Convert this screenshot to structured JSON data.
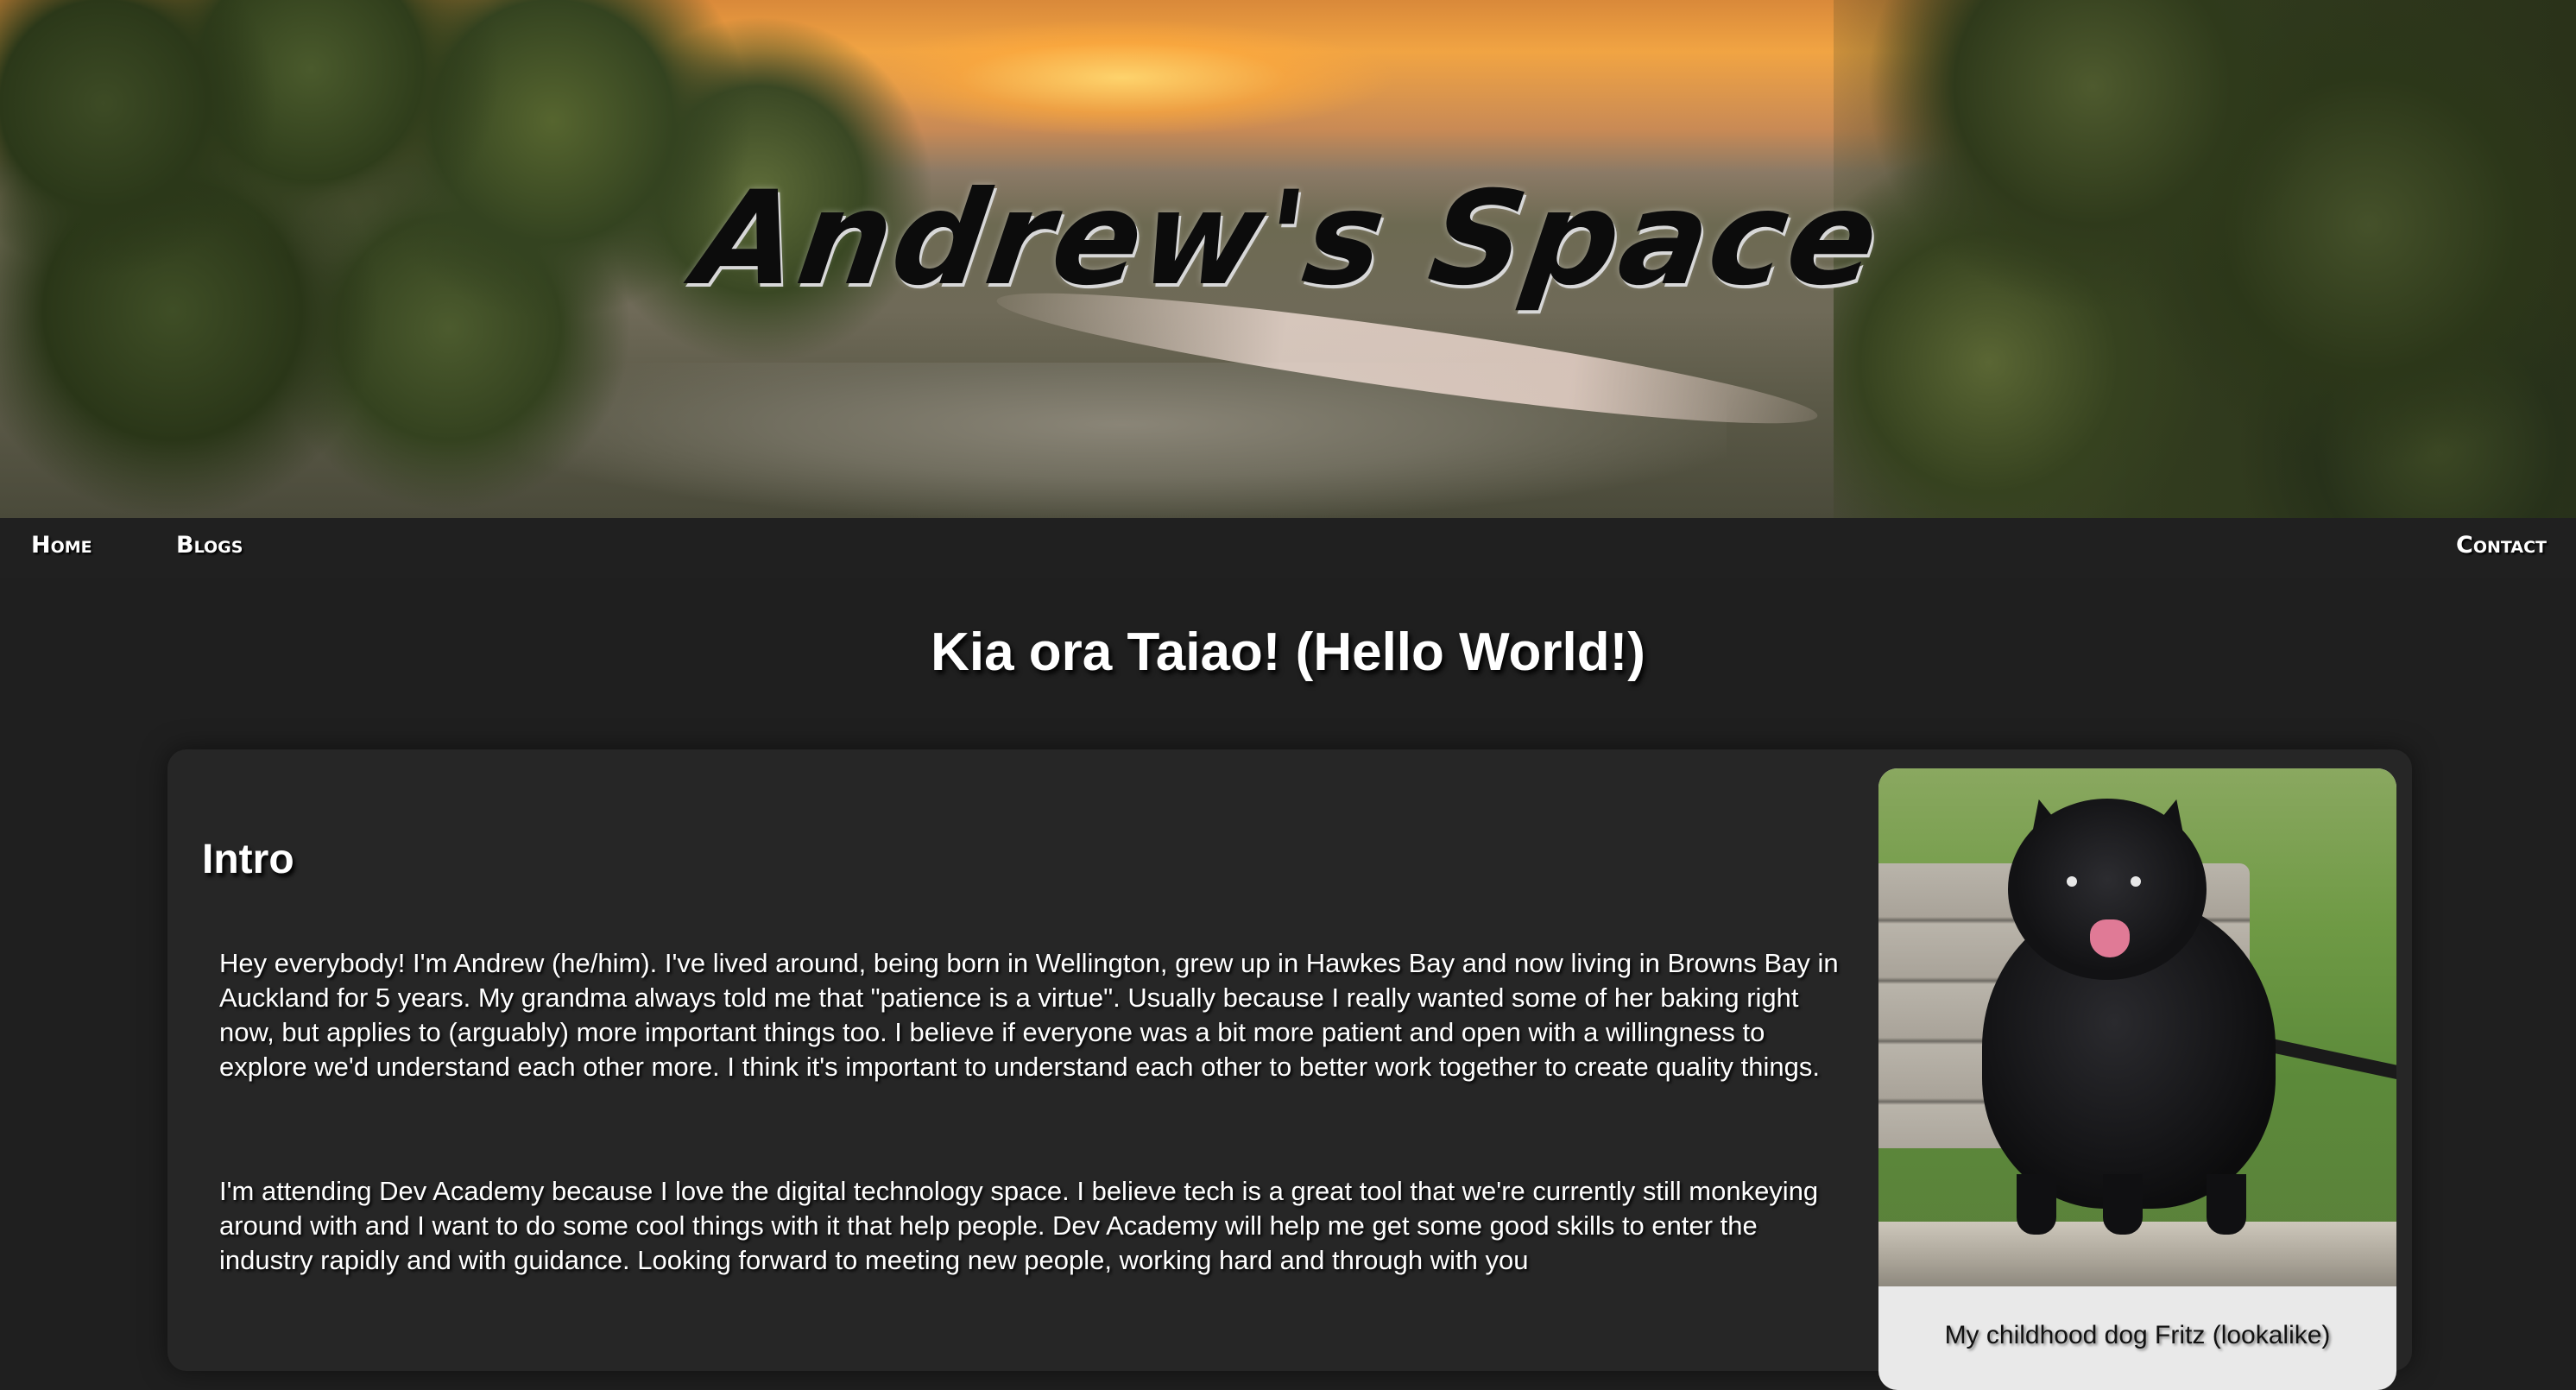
{
  "header": {
    "site_title": "Andrew's Space"
  },
  "nav": {
    "home": "Home",
    "blogs": "Blogs",
    "contact": "Contact"
  },
  "main": {
    "heading": "Kia ora Taiao! (Hello World!)",
    "section_title": "Intro",
    "paragraphs": [
      "Hey everybody! I'm Andrew (he/him). I've lived around, being born in Wellington, grew up in Hawkes Bay and now living in Browns Bay in Auckland for 5 years. My grandma always told me that \"patience is a virtue\". Usually because I really wanted some of her baking right now, but applies to (arguably) more important things too. I believe if everyone was a bit more patient and open with a willingness to explore we'd understand each other more. I think it's important to understand each other to better work together to create quality things.",
      "I'm attending Dev Academy because I love the digital technology space. I believe tech is a great tool that we're currently still monkeying around with and I want to do some cool things with it that help people. Dev Academy will help me get some good skills to enter the industry rapidly and with guidance. Looking forward to meeting new people, working hard and through with you"
    ],
    "photo_caption": "My childhood dog Fritz (lookalike)"
  },
  "colors": {
    "background": "#1f1f1f",
    "card": "#262626",
    "text": "#ffffff"
  }
}
